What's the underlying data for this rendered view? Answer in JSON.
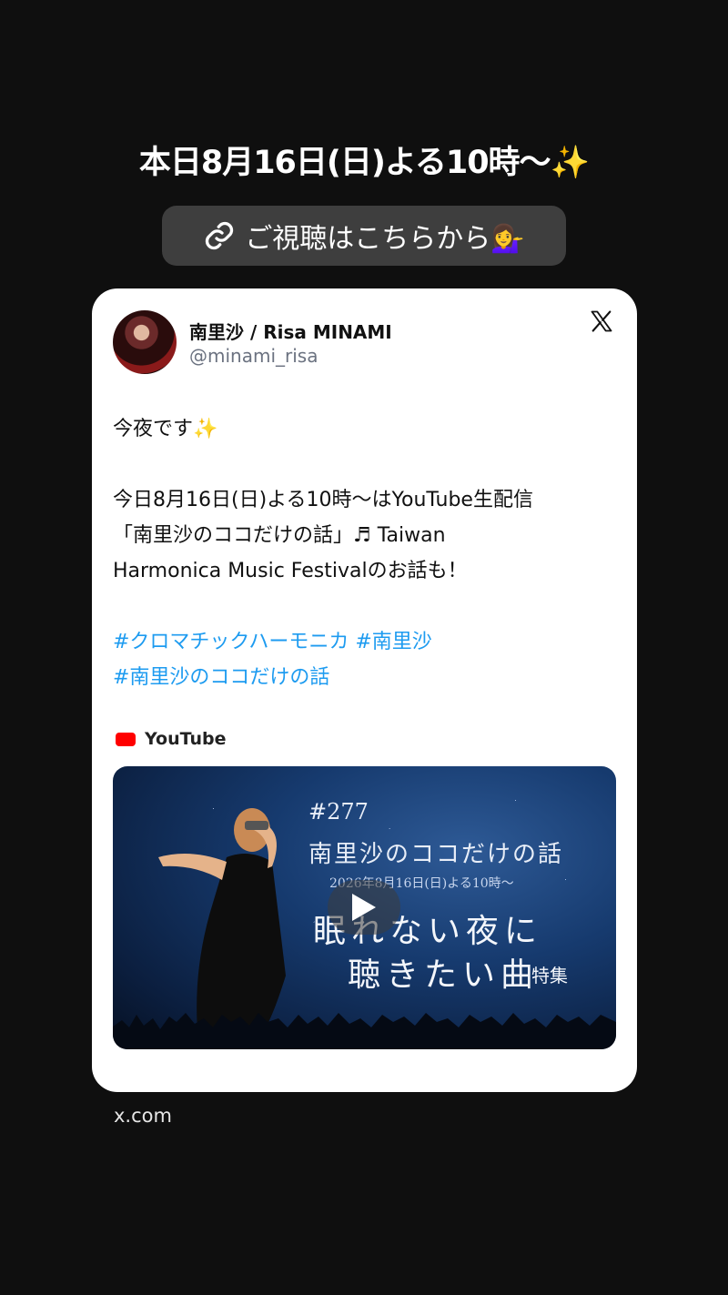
{
  "story": {
    "headline": "本日8月16日(日)よる10時〜✨",
    "link_sticker_label": "ご視聴はこちらから💁‍♀️",
    "link_icon": "link-icon"
  },
  "tweet": {
    "display_name": "南里沙 / Risa MINAMI",
    "handle": "@minami_risa",
    "platform_icon": "x-logo-icon",
    "line1": "今夜です✨",
    "line2": "今日8月16日(日)よる10時〜はYouTube生配信",
    "line3": "「南里沙のココだけの話」♬ Taiwan",
    "line4": "Harmonica Music Festivalのお話も！",
    "hashtags_line1": "#クロマチックハーモニカ #南里沙",
    "hashtags_line2": "#南里沙のココだけの話",
    "link_source": "YouTube",
    "link_color": "#1d9bf0"
  },
  "video_thumbnail": {
    "episode": "#277",
    "title": "南里沙のココだけの話",
    "date": "2026年8月16日(日)よる10時〜",
    "headline_line1": "眠れない夜に",
    "headline_line2": "聴きたい曲",
    "tag": "特集"
  },
  "footer": {
    "domain": "x.com"
  }
}
